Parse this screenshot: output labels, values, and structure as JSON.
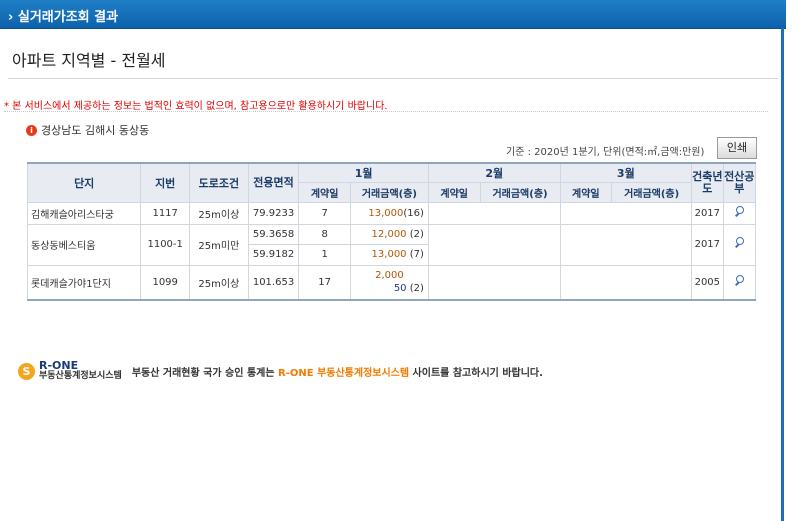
{
  "header": {
    "title": "› 실거래가조회 결과"
  },
  "page_title": "아파트 지역별 - 전월세",
  "notice": "* 본 서비스에서 제공하는 정보는 법적인 효력이 없으며, 참고용으로만 활용하시기 바랍니다.",
  "region": "경상남도 김해시 동상동",
  "criteria": "기준 : 2020년 1분기, 단위(면적:㎡,금액:만원)",
  "print_label": "인쇄",
  "table": {
    "headers": {
      "complex": "단지",
      "lot": "지번",
      "road": "도로조건",
      "area": "전용면적",
      "m1": "1월",
      "m2": "2월",
      "m3": "3월",
      "contract_day": "계약일",
      "amount": "거래금액(층)",
      "build_year": "건축년도",
      "ledger": "전산공부"
    },
    "rows": [
      {
        "complex": "김해캐슬아리스타궁",
        "lot": "1117",
        "road": "25m이상",
        "area": "79.9233",
        "day": "7",
        "amount": "13,000",
        "floor": "(16)",
        "year": "2017"
      },
      {
        "complex": "동상동베스티움",
        "lot": "1100-1",
        "road": "25m미만",
        "area": "59.3658",
        "day": "8",
        "amount": "12,000",
        "floor": "(2)",
        "year": "2017"
      },
      {
        "area": "59.9182",
        "day": "1",
        "amount": "13,000",
        "floor": "(7)"
      },
      {
        "complex": "롯데캐슬가야1단지",
        "lot": "1099",
        "road": "25m이상",
        "area": "101.653",
        "day": "17",
        "amount": "2,000",
        "amount2": "50",
        "floor": "(2)",
        "year": "2005"
      }
    ]
  },
  "footer": {
    "logo_line1": "R-ONE",
    "logo_line2": "부동산통계정보시스템",
    "text_before": "부동산 거래현황 국가 승인 통계는 ",
    "highlight": "R-ONE 부동산통계정보시스템",
    "text_after": " 사이트를 참고하시기 바랍니다."
  },
  "colors": {
    "header_blue": "#0d63ab",
    "notice_red": "#e00000",
    "amount_orange": "#b3570a",
    "highlight_orange": "#f27b00"
  }
}
